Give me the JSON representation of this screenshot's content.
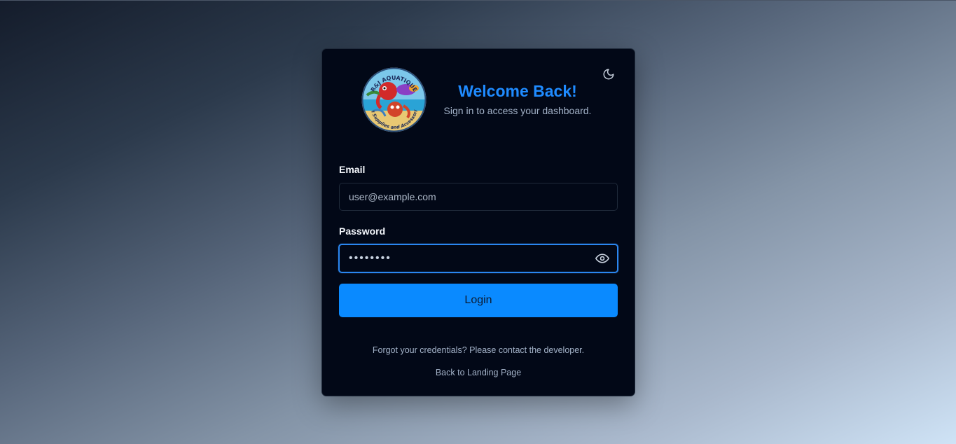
{
  "header": {
    "title": "Welcome Back!",
    "subtitle": "Sign in to access your dashboard."
  },
  "logo": {
    "text_top": "R&J AQUATIQUE",
    "text_bottom": "Pet Supplies and Accessories"
  },
  "form": {
    "email_label": "Email",
    "email_placeholder": "user@example.com",
    "password_label": "Password",
    "password_value": "••••••••",
    "login_label": "Login"
  },
  "footer": {
    "forgot_text": "Forgot your credentials? Please contact the developer.",
    "back_link": "Back to Landing Page"
  },
  "icons": {
    "theme_toggle": "moon-icon",
    "password_visibility": "eye-icon"
  },
  "colors": {
    "accent": "#0a8aff",
    "title": "#1f8bff",
    "card_bg": "#020817",
    "focus_ring": "#2a86f0"
  }
}
